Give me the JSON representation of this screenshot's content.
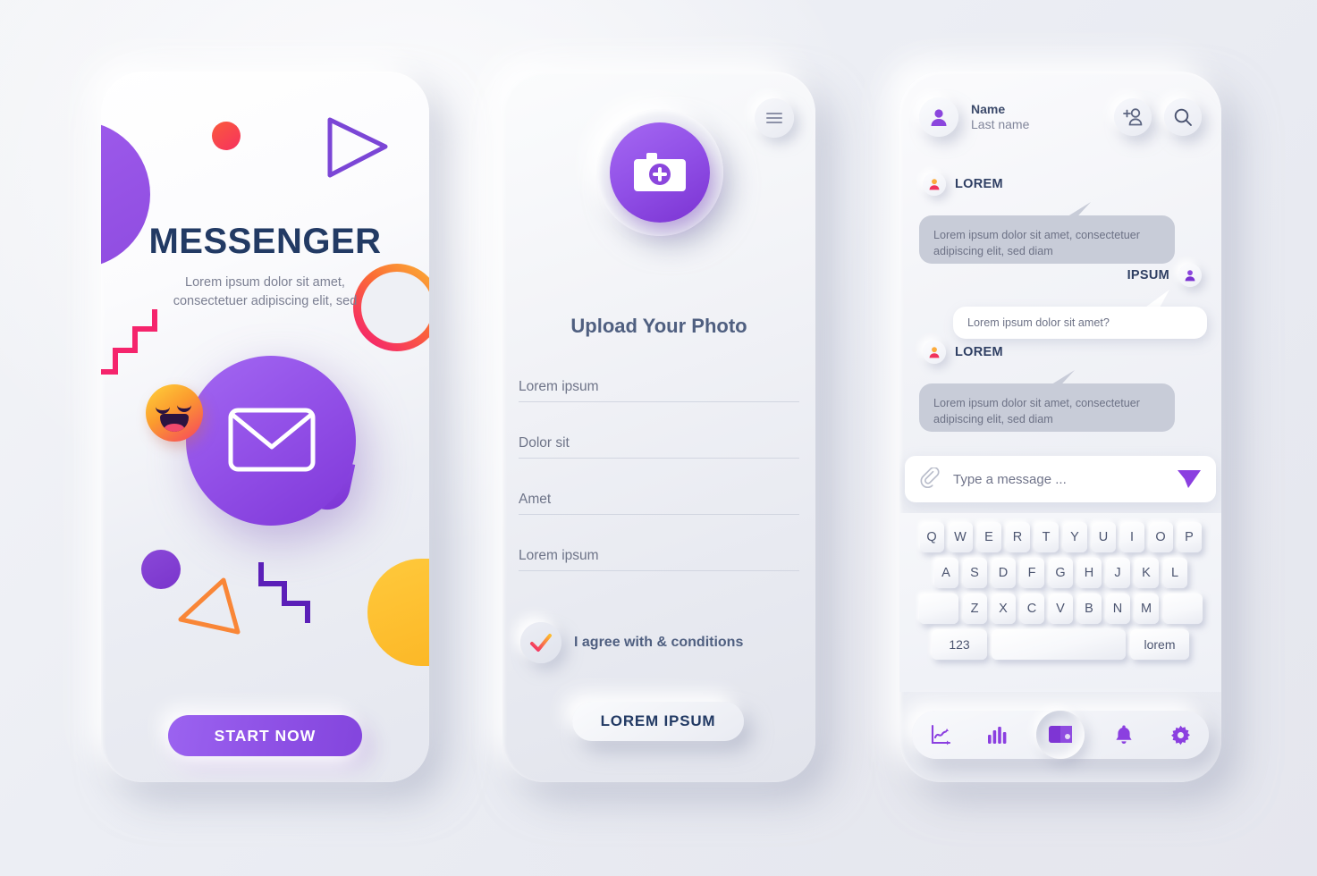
{
  "screen1": {
    "title": "MESSENGER",
    "subtitle": "Lorem ipsum dolor sit amet, consectetuer adipiscing elit, sed",
    "start_button": "START NOW"
  },
  "screen2": {
    "menu_icon": "hamburger-menu-icon",
    "camera_icon": "camera-add-icon",
    "title": "Upload Your Photo",
    "fields": [
      {
        "placeholder": "Lorem ipsum"
      },
      {
        "placeholder": "Dolor sit"
      },
      {
        "placeholder": "Amet"
      },
      {
        "placeholder": "Lorem ipsum"
      }
    ],
    "agree_label": "I agree with & conditions",
    "agree_checked": true,
    "submit_button": "LOREM IPSUM"
  },
  "screen3": {
    "header": {
      "name": "Name",
      "last_name": "Last name",
      "add_user_icon": "add-user-icon",
      "search_icon": "search-icon"
    },
    "messages": [
      {
        "sender": "LOREM",
        "side": "them",
        "text": "Lorem ipsum dolor sit amet, consectetuer adipiscing elit, sed diam"
      },
      {
        "sender": "IPSUM",
        "side": "me",
        "text": "Lorem ipsum dolor sit amet?"
      },
      {
        "sender": "LOREM",
        "side": "them",
        "text": "Lorem ipsum dolor sit amet, consectetuer adipiscing elit, sed diam"
      }
    ],
    "input": {
      "attach_icon": "paperclip-icon",
      "placeholder": "Type a message ...",
      "send_icon": "send-icon"
    },
    "keyboard": {
      "row1": [
        "Q",
        "W",
        "E",
        "R",
        "T",
        "Y",
        "U",
        "I",
        "O",
        "P"
      ],
      "row2": [
        "A",
        "S",
        "D",
        "F",
        "G",
        "H",
        "J",
        "K",
        "L"
      ],
      "row3": [
        "Z",
        "X",
        "C",
        "V",
        "B",
        "N",
        "M"
      ],
      "shift_key": "",
      "backspace_key": "",
      "num_key": "123",
      "space_key": "",
      "lang_key": "lorem"
    },
    "nav": [
      {
        "icon": "line-chart-icon",
        "active": false
      },
      {
        "icon": "bar-chart-icon",
        "active": false
      },
      {
        "icon": "wallet-icon",
        "active": true
      },
      {
        "icon": "bell-icon",
        "active": false
      },
      {
        "icon": "gear-icon",
        "active": false
      }
    ]
  },
  "colors": {
    "purple": "#8f4ce0",
    "navy": "#223a64",
    "slate": "#4f5f80",
    "bubble_them": "#c8ccd8"
  }
}
